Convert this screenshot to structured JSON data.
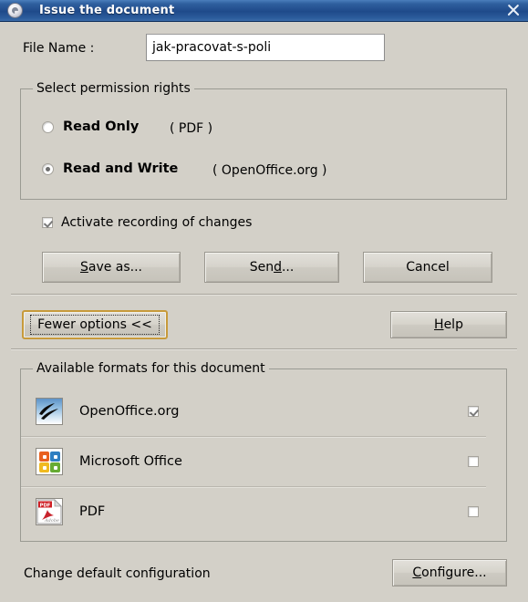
{
  "window": {
    "title": "Issue the document",
    "icon": "clock-icon",
    "close_label": "×",
    "titlebar_color": "#1f4a8a",
    "background_color": "#d3d0c8"
  },
  "filename": {
    "label": "File Name :",
    "value": "jak-pracovat-s-poli",
    "placeholder": ""
  },
  "permissions": {
    "legend": "Select permission rights",
    "options": [
      {
        "label": "Read Only",
        "note": "( PDF )",
        "selected": false
      },
      {
        "label": "Read and Write",
        "note": "( OpenOffice.org )",
        "selected": true
      }
    ]
  },
  "recording": {
    "label": "Activate recording of changes",
    "checked": true
  },
  "actions": {
    "save_as": "Save as...",
    "save_as_pre": "S",
    "save_as_post": "ave as...",
    "send_pre": "Sen",
    "send_accel": "d",
    "send_post": "...",
    "cancel": "Cancel",
    "fewer_options": "Fewer options <<",
    "help_pre": "H",
    "help_accel": "H",
    "help_post": "elp",
    "help": "Help",
    "configure_pre": "C",
    "configure_post": "onfigure...",
    "configure": "Configure..."
  },
  "formats": {
    "legend": "Available formats for this document",
    "items": [
      {
        "name": "OpenOffice.org",
        "icon": "openoffice-icon",
        "checked": true
      },
      {
        "name": "Microsoft Office",
        "icon": "microsoft-office-icon",
        "checked": false
      },
      {
        "name": "PDF",
        "icon": "pdf-icon",
        "checked": false
      }
    ]
  },
  "footer": {
    "change_default_label": "Change default configuration"
  }
}
